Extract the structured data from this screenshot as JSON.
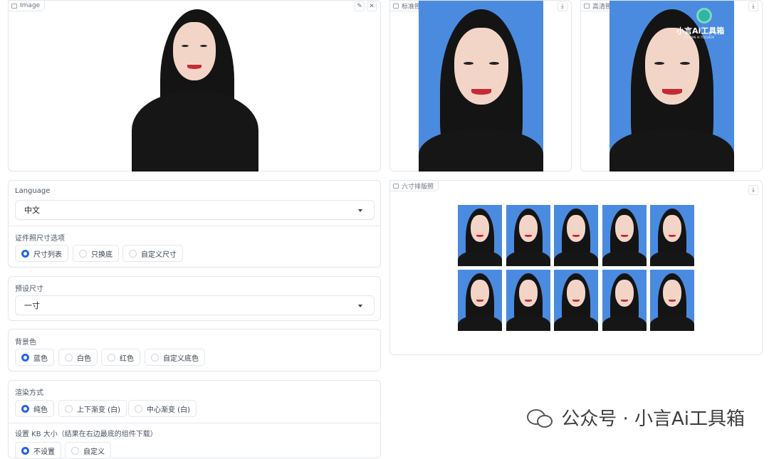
{
  "image_panel": {
    "label": "Image",
    "edit_icon": "pencil-icon",
    "close_icon": "close-icon"
  },
  "standard_photo": {
    "label": "标准照",
    "download_icon": "download-icon"
  },
  "hd_photo": {
    "label": "高清照",
    "download_icon": "download-icon",
    "logo_text": "小言Ai工具箱",
    "logo_subtext": "XIAOYAN AI TOOLBOX"
  },
  "layout_photo": {
    "label": "六寸排版照",
    "download_icon": "download-icon"
  },
  "language": {
    "label": "Language",
    "value": "中文"
  },
  "size_options": {
    "label": "证件照尺寸选项",
    "options": [
      "尺寸列表",
      "只换底",
      "自定义尺寸"
    ],
    "selected": 0
  },
  "preset_size": {
    "label": "预设尺寸",
    "value": "一寸"
  },
  "background_color": {
    "label": "背景色",
    "options": [
      "蓝色",
      "白色",
      "红色",
      "自定义底色"
    ],
    "selected": 0
  },
  "render_mode": {
    "label": "渲染方式",
    "options": [
      "纯色",
      "上下渐变 (白)",
      "中心渐变 (白)"
    ],
    "selected": 0
  },
  "kb_size": {
    "label": "设置 KB 大小（结果在右边最底的组件下载）",
    "options": [
      "不设置",
      "自定义"
    ],
    "selected": 0
  },
  "watermark": {
    "text": "公众号 · 小言Ai工具箱"
  },
  "colors": {
    "accent": "#2563eb",
    "photo_blue": "#4a8be0"
  }
}
